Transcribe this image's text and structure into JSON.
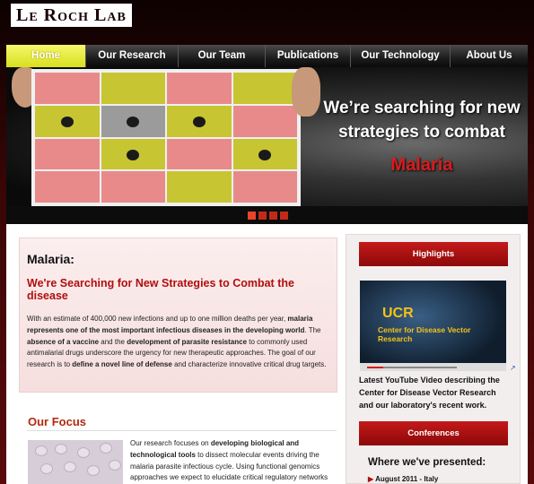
{
  "header": {
    "site_title": "Le Roch Lab"
  },
  "nav": {
    "items": [
      {
        "label": "Home",
        "active": true
      },
      {
        "label": "Our Research",
        "active": false
      },
      {
        "label": "Our Team",
        "active": false
      },
      {
        "label": "Publications",
        "active": false
      },
      {
        "label": "Our Technology",
        "active": false
      },
      {
        "label": "About Us",
        "active": false
      }
    ]
  },
  "banner": {
    "headline_line1": "We’re searching for new",
    "headline_line2": "strategies to combat",
    "accent": "Malaria",
    "slide_count": 4,
    "active_slide": 1
  },
  "intro": {
    "heading": "Malaria:",
    "subheading": "We're Searching for New Strategies to Combat the disease",
    "body_parts": [
      {
        "t": "With an estimate of 400,000 new infections and up to one million deaths per year, ",
        "b": false
      },
      {
        "t": "malaria represents one of the most important infectious diseases in the developing world",
        "b": true
      },
      {
        "t": ". The ",
        "b": false
      },
      {
        "t": "absence of a vaccine",
        "b": true
      },
      {
        "t": " and the ",
        "b": false
      },
      {
        "t": "development of parasite resistance",
        "b": true
      },
      {
        "t": " to commonly used antimalarial drugs underscore the urgency for new therapeutic approaches. The goal of our research is to ",
        "b": false
      },
      {
        "t": "define a novel line of defense",
        "b": true
      },
      {
        "t": " and characterize innovative critical drug targets.",
        "b": false
      }
    ]
  },
  "focus": {
    "heading": "Our Focus",
    "body_parts": [
      {
        "t": "Our research focuses on ",
        "b": false
      },
      {
        "t": "developing biological and technological tools",
        "b": true
      },
      {
        "t": " to dissect molecular events driving the malaria parasite infectious cycle. Using functional genomics approaches we expect to elucidate critical regulatory networks",
        "b": false
      }
    ]
  },
  "sidebar": {
    "highlights_label": "Highlights",
    "video": {
      "logo": "UCR",
      "caption": "Center for Disease Vector Research",
      "progress": 0.18
    },
    "video_description": "Latest YouTube Video describing the Center for Disease Vector Research and our laboratory's recent work.",
    "conferences_label": "Conferences",
    "where_heading": "Where we've presented:",
    "where_items": [
      "August 2011 - Italy"
    ]
  }
}
